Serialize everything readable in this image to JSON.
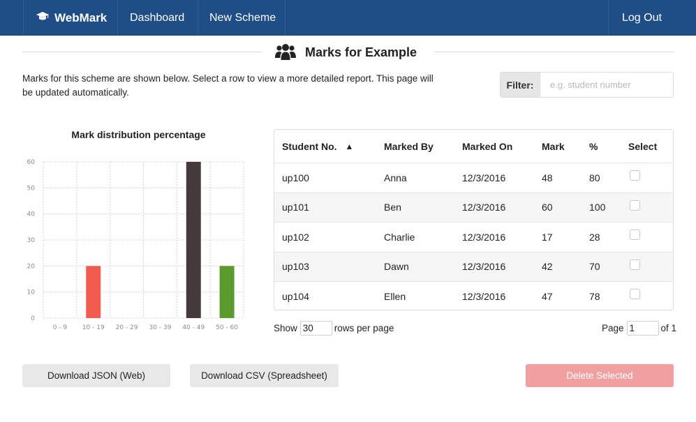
{
  "nav": {
    "brand": "WebMark",
    "dashboard": "Dashboard",
    "new_scheme": "New Scheme",
    "logout": "Log Out"
  },
  "page": {
    "title": "Marks for Example",
    "intro": "Marks for this scheme are shown below. Select a row to view a more detailed report. This page will be updated automatically."
  },
  "filter": {
    "label": "Filter:",
    "placeholder": "e.g. student number",
    "value": ""
  },
  "chart_data": {
    "type": "bar",
    "title": "Mark distribution percentage",
    "xlabel": "",
    "ylabel": "",
    "categories": [
      "0 - 9",
      "10 - 19",
      "20 - 29",
      "30 - 39",
      "40 - 49",
      "50 - 60"
    ],
    "values": [
      0,
      20,
      0,
      0,
      60,
      20
    ],
    "colors": [
      "#f25c4e",
      "#f25c4e",
      "#f25c4e",
      "#f25c4e",
      "#433b3b",
      "#5a9a2e"
    ],
    "ylim": [
      0,
      60
    ],
    "yticks": [
      0,
      10,
      20,
      30,
      40,
      50,
      60
    ],
    "grid": true,
    "legend": "none"
  },
  "table": {
    "headers": [
      "Student No.",
      "Marked By",
      "Marked On",
      "Mark",
      "%",
      "Select"
    ],
    "sort_indicator": "▲",
    "rows": [
      [
        "up100",
        "Anna",
        "12/3/2016",
        "48",
        "80"
      ],
      [
        "up101",
        "Ben",
        "12/3/2016",
        "60",
        "100"
      ],
      [
        "up102",
        "Charlie",
        "12/3/2016",
        "17",
        "28"
      ],
      [
        "up103",
        "Dawn",
        "12/3/2016",
        "42",
        "70"
      ],
      [
        "up104",
        "Ellen",
        "12/3/2016",
        "47",
        "78"
      ]
    ]
  },
  "pagination": {
    "show_label": "Show",
    "rows_per_page": "30",
    "rows_per_page_label": "rows per page",
    "page_label": "Page",
    "current_page": "1",
    "of_label": "of 1"
  },
  "buttons": {
    "download_json": "Download JSON (Web)",
    "download_csv": "Download CSV (Spreadsheet)",
    "delete_selected": "Delete Selected"
  },
  "icons": {
    "brand": "graduation-cap-icon",
    "title": "users-icon",
    "sort": "sort-ascending-icon"
  },
  "colors": {
    "navbar": "#1f4e87",
    "delete_button": "#f0a0a0"
  }
}
